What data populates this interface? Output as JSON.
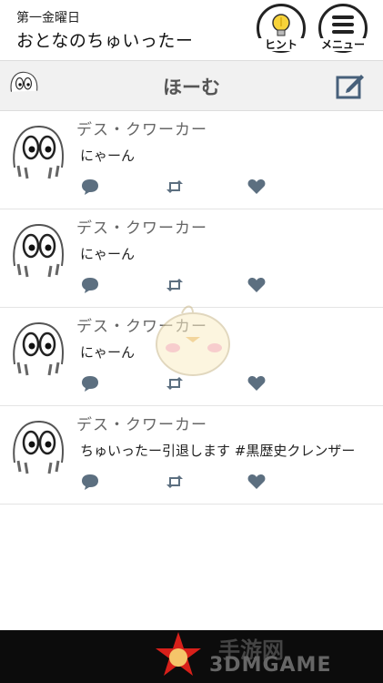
{
  "header": {
    "day": "第一金曜日",
    "title": "おとなのちゅいったー",
    "hint_label": "ヒント",
    "menu_label": "メニュー"
  },
  "homebar": {
    "title": "ほーむ"
  },
  "posts": [
    {
      "author": "デス・クワーカー",
      "text": "にゃーん"
    },
    {
      "author": "デス・クワーカー",
      "text": "にゃーん"
    },
    {
      "author": "デス・クワーカー",
      "text": "にゃーん"
    },
    {
      "author": "デス・クワーカー",
      "text": "ちゅいったー引退します #黒歴史クレンザー"
    }
  ],
  "watermark": {
    "brand": "3DMGAME",
    "cn": "手游网"
  },
  "colors": {
    "icon": "#5c6f80",
    "compose": "#47607a",
    "homebar_bg": "#f1f1f1"
  },
  "icons": [
    "lightbulb-icon",
    "hamburger-menu-icon",
    "compose-icon",
    "reply-icon",
    "retweet-icon",
    "heart-icon"
  ]
}
